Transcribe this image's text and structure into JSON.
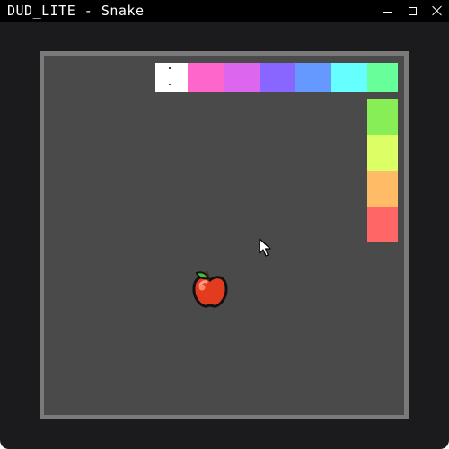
{
  "window": {
    "title": "DUD_LITE - Snake",
    "controls": [
      "minimize-icon",
      "maximize-icon",
      "close-icon"
    ]
  },
  "colors": {
    "window_bg": "#1b1b1d",
    "titlebar_bg": "#000000",
    "board_bg": "#4a4a4a",
    "board_border": "#7a7a7a"
  },
  "game": {
    "grid_columns": 10,
    "grid_rows": 10,
    "snake": [
      {
        "col": 3,
        "row": 1,
        "color": "#ffffff",
        "head": true
      },
      {
        "col": 4,
        "row": 1,
        "color": "#ff66cc"
      },
      {
        "col": 5,
        "row": 1,
        "color": "#dd66ee"
      },
      {
        "col": 6,
        "row": 1,
        "color": "#8866ff"
      },
      {
        "col": 7,
        "row": 1,
        "color": "#6699ff"
      },
      {
        "col": 8,
        "row": 1,
        "color": "#66ffff"
      },
      {
        "col": 9,
        "row": 1,
        "color": "#66ff99"
      },
      {
        "col": 9,
        "row": 2,
        "color": "#88ee55"
      },
      {
        "col": 9,
        "row": 3,
        "color": "#ddff66"
      },
      {
        "col": 9,
        "row": 4,
        "color": "#ffbb66"
      },
      {
        "col": 9,
        "row": 5,
        "color": "#ff6666"
      }
    ],
    "apple": {
      "col": 4,
      "row": 6,
      "icon": "apple-icon"
    },
    "cursor_icon": "mouse-pointer-icon"
  }
}
